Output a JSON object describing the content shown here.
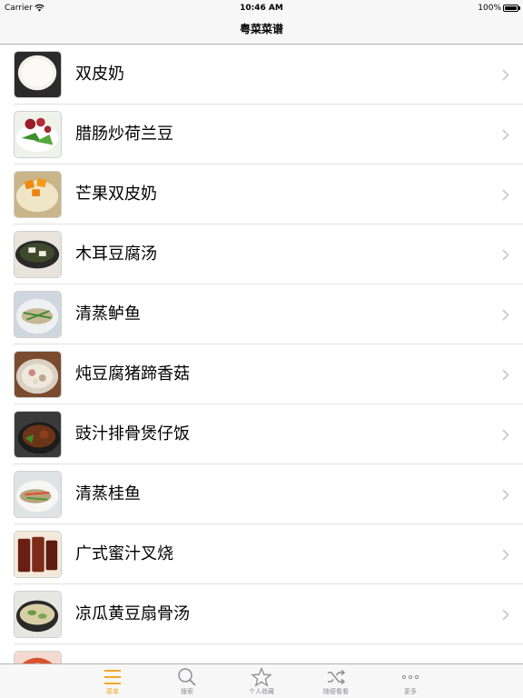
{
  "status_bar": {
    "carrier": "Carrier",
    "time": "10:46 AM",
    "battery": "100%",
    "battery_level": 1.0
  },
  "nav": {
    "title": "粤菜菜谱"
  },
  "recipes": [
    {
      "name": "双皮奶",
      "thumb_icon": "milk-pudding-photo"
    },
    {
      "name": "腊肠炒荷兰豆",
      "thumb_icon": "sausage-peas-photo"
    },
    {
      "name": "芒果双皮奶",
      "thumb_icon": "mango-pudding-photo"
    },
    {
      "name": "木耳豆腐汤",
      "thumb_icon": "tofu-soup-photo"
    },
    {
      "name": "清蒸鲈鱼",
      "thumb_icon": "steamed-bass-photo"
    },
    {
      "name": "炖豆腐猪蹄香菇",
      "thumb_icon": "trotter-stew-photo"
    },
    {
      "name": "豉汁排骨煲仔饭",
      "thumb_icon": "claypot-rice-photo"
    },
    {
      "name": "清蒸桂鱼",
      "thumb_icon": "steamed-mandarin-fish-photo"
    },
    {
      "name": "广式蜜汁叉烧",
      "thumb_icon": "char-siu-photo"
    },
    {
      "name": "凉瓜黄豆扇骨汤",
      "thumb_icon": "bitter-melon-soup-photo"
    },
    {
      "name": "",
      "thumb_icon": "shrimp-photo"
    }
  ],
  "tabs": [
    {
      "label": "菜单",
      "icon": "menu-list-icon",
      "active": true
    },
    {
      "label": "搜索",
      "icon": "search-icon",
      "active": false
    },
    {
      "label": "个人收藏",
      "icon": "star-icon",
      "active": false
    },
    {
      "label": "随便看看",
      "icon": "shuffle-icon",
      "active": false
    },
    {
      "label": "更多",
      "icon": "more-dots-icon",
      "active": false
    }
  ],
  "colors": {
    "accent": "#f5a623",
    "tab_inactive": "#8e8e93",
    "separator": "#e0e0e0",
    "chevron": "#c7c7cc"
  }
}
